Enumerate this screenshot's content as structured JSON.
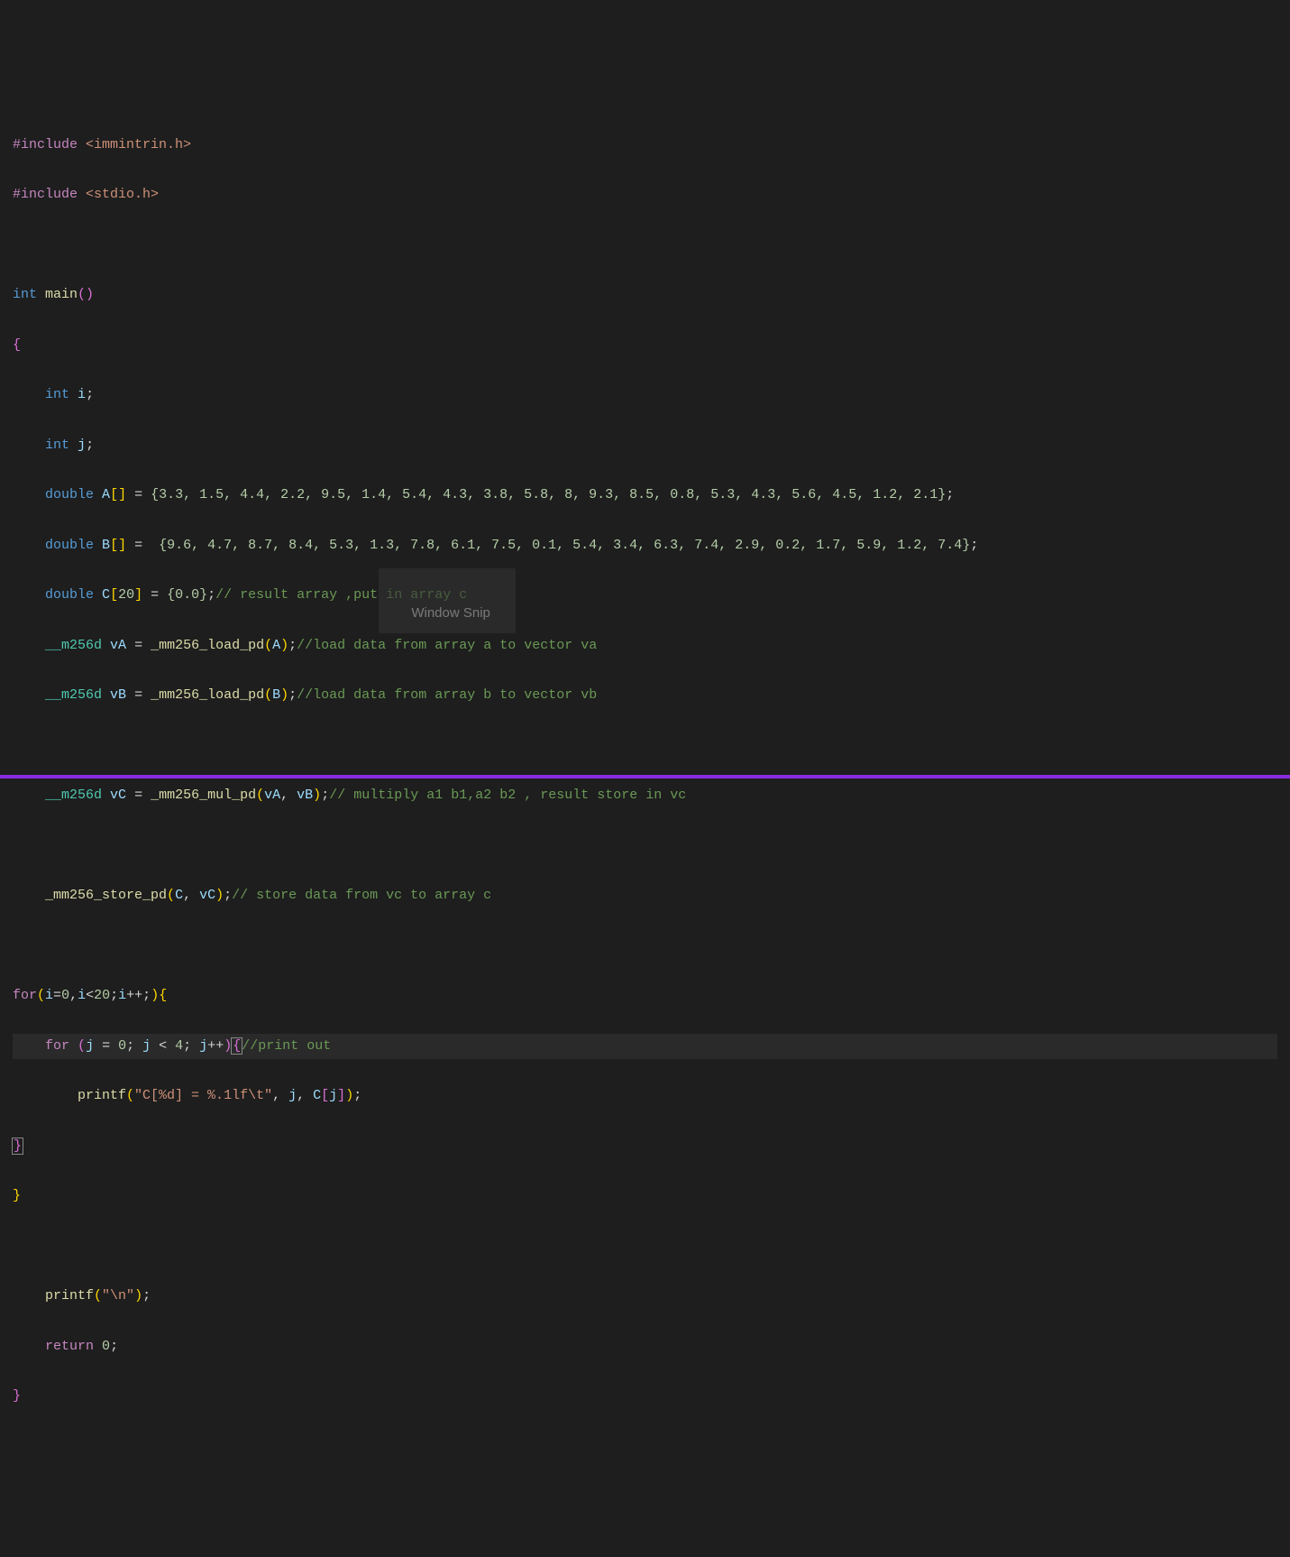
{
  "code": {
    "line1_include": "#include",
    "line1_header": "<immintrin.h>",
    "line2_include": "#include",
    "line2_header": "<stdio.h>",
    "line4_type": "int",
    "line4_func": "main",
    "line6_type": "int",
    "line6_var": "i",
    "line7_type": "int",
    "line7_var": "j",
    "line8_type": "double",
    "line8_var": "A",
    "line8_vals": "{3.3, 1.5, 4.4, 2.2, 9.5, 1.4, 5.4, 4.3, 3.8, 5.8, 8, 9.3, 8.5, 0.8, 5.3, 4.3, 5.6, 4.5, 1.2, 2.1}",
    "line9_type": "double",
    "line9_var": "B",
    "line9_vals": "{9.6, 4.7, 8.7, 8.4, 5.3, 1.3, 7.8, 6.1, 7.5, 0.1, 5.4, 3.4, 6.3, 7.4, 2.9, 0.2, 1.7, 5.9, 1.2, 7.4}",
    "line10_type": "double",
    "line10_var": "C",
    "line10_size": "20",
    "line10_init": "{0.0}",
    "line10_comment": "// result array ,put in array c",
    "line11_type": "__m256d",
    "line11_var": "vA",
    "line11_func": "_mm256_load_pd",
    "line11_arg": "A",
    "line11_comment": "//load data from array a to vector va",
    "line12_type": "__m256d",
    "line12_var": "vB",
    "line12_func": "_mm256_load_pd",
    "line12_arg": "B",
    "line12_comment": "//load data from array b to vector vb",
    "line14_type": "__m256d",
    "line14_var": "vC",
    "line14_func": "_mm256_mul_pd",
    "line14_arg1": "vA",
    "line14_arg2": "vB",
    "line14_comment": "// multiply a1 b1,a2 b2 , result store in vc",
    "line16_func": "_mm256_store_pd",
    "line16_arg1": "C",
    "line16_arg2": "vC",
    "line16_comment": "// store data from vc to array c",
    "line18_for": "for",
    "line18_i": "i",
    "line18_zero": "0",
    "line18_cond": "20",
    "line19_for": "for",
    "line19_j": "j",
    "line19_zero": "0",
    "line19_cond": "4",
    "line19_comment": "//print out",
    "line20_func": "printf",
    "line20_str": "\"C[%d] = %.1lf\\t\"",
    "line20_arg1": "j",
    "line20_arg2": "C",
    "line20_arg3": "j",
    "line24_func": "printf",
    "line24_str": "\"\\n\"",
    "line25_return": "return",
    "line25_val": "0"
  },
  "overlay": {
    "text": "Window Snip"
  }
}
